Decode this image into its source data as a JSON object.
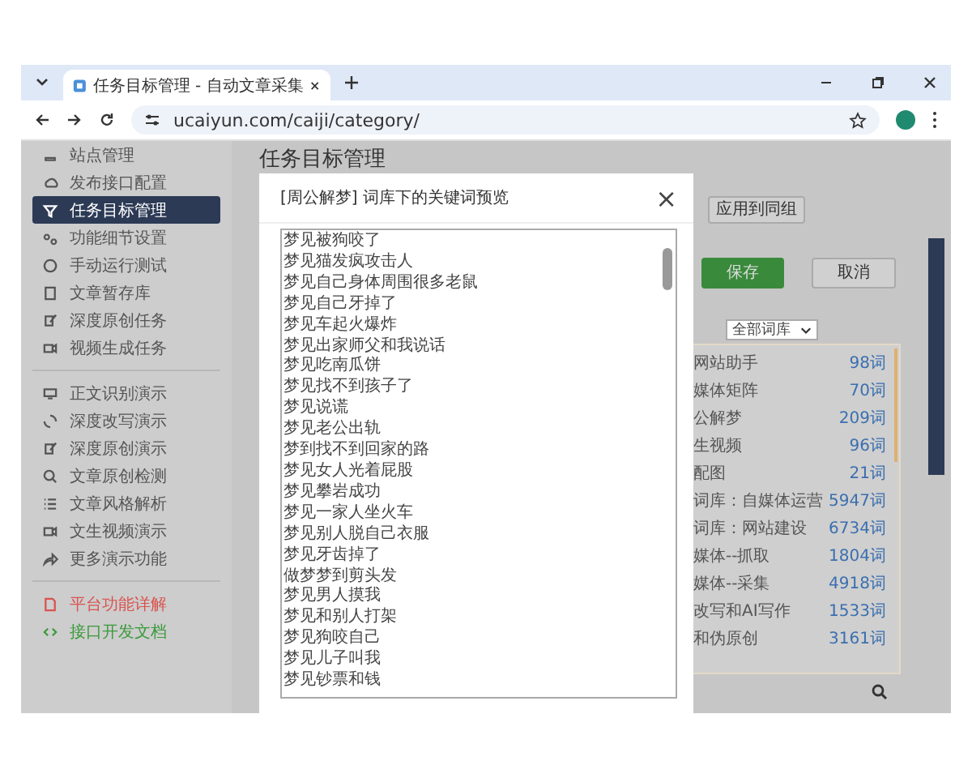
{
  "browser": {
    "tab_title": "任务目标管理 - 自动文章采集",
    "url": "ucaiyun.com/caiji/category/"
  },
  "sidebar": {
    "groups": [
      {
        "items": [
          {
            "label": "站点管理",
            "selected": false
          },
          {
            "label": "发布接口配置",
            "selected": false
          },
          {
            "label": "任务目标管理",
            "selected": true
          },
          {
            "label": "功能细节设置",
            "selected": false
          },
          {
            "label": "手动运行测试",
            "selected": false
          },
          {
            "label": "文章暂存库",
            "selected": false
          },
          {
            "label": "深度原创任务",
            "selected": false
          },
          {
            "label": "视频生成任务",
            "selected": false
          }
        ]
      },
      {
        "items": [
          {
            "label": "正文识别演示",
            "selected": false
          },
          {
            "label": "深度改写演示",
            "selected": false
          },
          {
            "label": "深度原创演示",
            "selected": false
          },
          {
            "label": "文章原创检测",
            "selected": false
          },
          {
            "label": "文章风格解析",
            "selected": false
          },
          {
            "label": "文生视频演示",
            "selected": false
          },
          {
            "label": "更多演示功能",
            "selected": false
          }
        ]
      },
      {
        "items": [
          {
            "label": "平台功能详解",
            "selected": false,
            "color": "#d9534f"
          },
          {
            "label": "接口开发文档",
            "selected": false,
            "color": "#3a9a3a"
          }
        ]
      }
    ]
  },
  "page_title": "任务目标管理",
  "apply_button": "应用到同组",
  "save_button": "保存",
  "cancel_button": "取消",
  "library_select": "全部词库",
  "libraries": [
    {
      "name": "网站助手",
      "count": "98词"
    },
    {
      "name": "媒体矩阵",
      "count": "70词"
    },
    {
      "name": "公解梦",
      "count": "209词"
    },
    {
      "name": "生视频",
      "count": "96词"
    },
    {
      "name": "配图",
      "count": "21词"
    },
    {
      "name": "词库：自媒体运营",
      "count": "5947词"
    },
    {
      "name": "词库：网站建设",
      "count": "6734词"
    },
    {
      "name": "媒体--抓取",
      "count": "1804词"
    },
    {
      "name": "媒体--采集",
      "count": "4918词"
    },
    {
      "name": "改写和AI写作",
      "count": "1533词"
    },
    {
      "name": "和伪原创",
      "count": "3161词"
    }
  ],
  "modal": {
    "title": "[周公解梦] 词库下的关键词预览",
    "close": "×",
    "keywords": [
      "梦见被狗咬了",
      "梦见猫发疯攻击人",
      "梦见自己身体周围很多老鼠",
      "梦见自己牙掉了",
      "梦见车起火爆炸",
      "梦见出家师父和我说话",
      "梦见吃南瓜饼",
      "梦见找不到孩子了",
      "梦见说谎",
      "梦见老公出轨",
      "梦到找不到回家的路",
      "梦见女人光着屁股",
      "梦见攀岩成功",
      "梦见一家人坐火车",
      "梦见别人脱自己衣服",
      "梦见牙齿掉了",
      "做梦梦到剪头发",
      "梦见男人摸我",
      "梦见和别人打架",
      "梦见狗咬自己",
      "梦见儿子叫我",
      "梦见钞票和钱"
    ]
  }
}
